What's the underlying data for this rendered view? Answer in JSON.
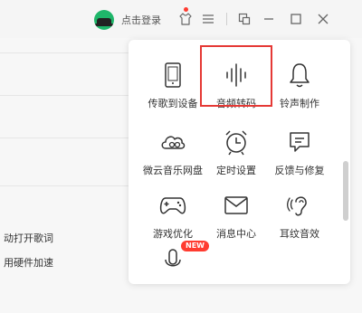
{
  "titlebar": {
    "login_text": "点击登录",
    "icons": [
      "avatar-icon",
      "skin-icon",
      "menu-icon",
      "mini-mode-icon",
      "minimize-icon",
      "maximize-icon",
      "close-icon"
    ]
  },
  "background": {
    "items": [
      {
        "label": "动打开歌词"
      },
      {
        "label": "用硬件加速"
      }
    ]
  },
  "tools": [
    {
      "label": "传歌到设备",
      "icon": "phone-icon"
    },
    {
      "label": "音频转码",
      "icon": "audio-convert-icon"
    },
    {
      "label": "铃声制作",
      "icon": "bell-icon"
    },
    {
      "label": "微云音乐网盘",
      "icon": "cloud-disk-icon"
    },
    {
      "label": "定时设置",
      "icon": "alarm-clock-icon"
    },
    {
      "label": "反馈与修复",
      "icon": "feedback-icon"
    },
    {
      "label": "游戏优化",
      "icon": "gamepad-icon"
    },
    {
      "label": "消息中心",
      "icon": "mail-icon"
    },
    {
      "label": "耳纹音效",
      "icon": "ear-icon"
    }
  ],
  "extra_tool": {
    "badge": "NEW",
    "icon": "microphone-icon"
  },
  "colors": {
    "accent_green": "#1fb66a",
    "highlight_red": "#e53935",
    "badge_red": "#ff3b30"
  }
}
